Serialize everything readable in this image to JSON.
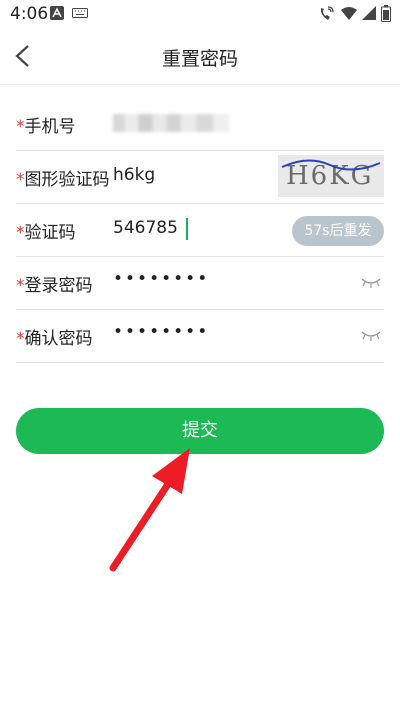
{
  "status": {
    "time": "4:06"
  },
  "header": {
    "title": "重置密码"
  },
  "form": {
    "required_mark": "*",
    "phone": {
      "label": "手机号"
    },
    "image_code": {
      "label": "图形验证码",
      "value": "h6kg",
      "captcha_text": "H6KG"
    },
    "sms_code": {
      "label": "验证码",
      "value": "546785",
      "resend_label": "57s后重发"
    },
    "login_password": {
      "label": "登录密码",
      "masked": "••••••••"
    },
    "confirm_password": {
      "label": "确认密码",
      "masked": "••••••••"
    }
  },
  "actions": {
    "submit_label": "提交"
  },
  "colors": {
    "primary": "#1db954",
    "required": "#e53935",
    "resend_bg": "#b9c4cc",
    "annotation_arrow": "#ee1c24"
  },
  "icons": {
    "back": "chevron-left-icon",
    "notification_a": "a-badge-icon",
    "keyboard": "keyboard-icon",
    "call_wifi": "wifi-calling-icon",
    "wifi": "wifi-icon",
    "signal": "signal-icon",
    "battery": "battery-icon",
    "eye_closed": "eye-closed-icon"
  }
}
